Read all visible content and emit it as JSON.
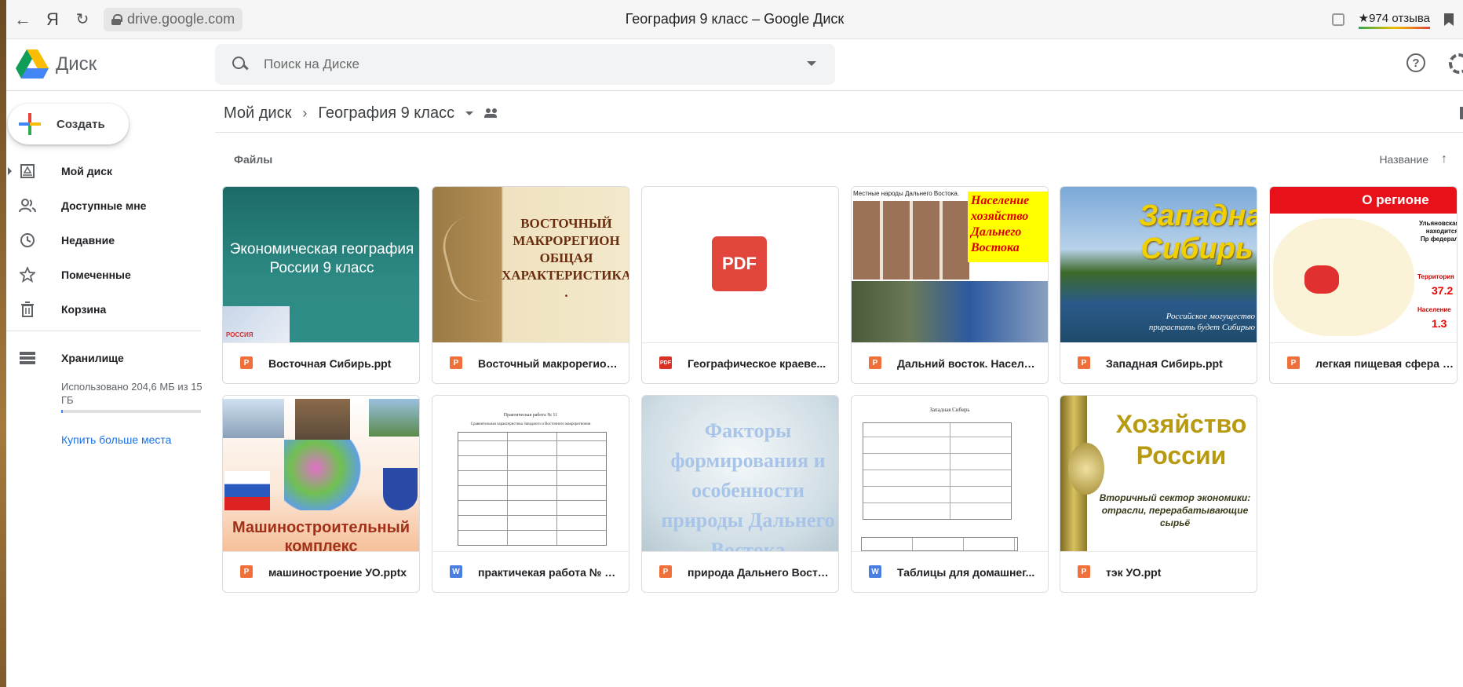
{
  "browser": {
    "url": "drive.google.com",
    "title": "География 9 класс – Google Диск",
    "reviews": "★974 отзыва",
    "logo_letter": "Я"
  },
  "header": {
    "app_name": "Диск",
    "search_placeholder": "Поиск на Диске"
  },
  "sidebar": {
    "create_label": "Создать",
    "items": [
      {
        "label": "Мой диск",
        "icon": "my-drive-icon"
      },
      {
        "label": "Доступные мне",
        "icon": "shared-icon"
      },
      {
        "label": "Недавние",
        "icon": "clock-icon"
      },
      {
        "label": "Помеченные",
        "icon": "star-icon"
      },
      {
        "label": "Корзина",
        "icon": "trash-icon"
      },
      {
        "label": "Хранилище",
        "icon": "storage-icon"
      }
    ],
    "storage_text": "Использовано 204,6 МБ из 15 ГБ",
    "storage_fraction": 0.013,
    "buy_more": "Купить больше места"
  },
  "breadcrumb": {
    "root": "Мой диск",
    "current": "География 9 класс"
  },
  "files_section": {
    "label": "Файлы",
    "sort_label": "Название"
  },
  "thumbs": {
    "t1": "Экономическая география России 9 класс",
    "t1_small": "РОССИЯ",
    "t2": "ВОСТОЧНЫЙ МАКРОРЕГИОН ОБЩАЯ ХАРАКТЕРИСТИКА .",
    "t3": "PDF",
    "t4_head": "Местные народы Дальнего Востока.",
    "t4_box": "Население хозяйство Дальнего Востока",
    "t5_big": "Западная Сибирь",
    "t5_small": "Российское могущество прирастать будет Сибирью",
    "t6_head": "О регионе",
    "t6_a": "Ульяновская находится Пр федерал",
    "t6_b": "Территория",
    "t6_c": "37.2",
    "t6_d": "Население",
    "t6_e": "1.3",
    "t7": "Машиностроительный комплекс",
    "t8_head": "Практическая работа № 11",
    "t8_sub": "Сравнительная характеристика Западного и Восточного макрорегионов",
    "t9": "Факторы формирования и особенности природы Дальнего Востока",
    "t10_head": "Западная Сибирь",
    "t11_big": "Хозяйство России",
    "t11_small": "Вторичный сектор экономики: отрасли, перерабатывающие сырьё"
  },
  "files": [
    {
      "name": "Восточная Сибирь.ppt",
      "type": "ppt",
      "type_letter": "P"
    },
    {
      "name": "Восточный макрорегион...",
      "type": "ppt",
      "type_letter": "P"
    },
    {
      "name": "Географическое краеве...",
      "type": "pdf",
      "type_letter": "PDF"
    },
    {
      "name": "Дальний восток. Населе...",
      "type": "ppt",
      "type_letter": "P"
    },
    {
      "name": "Западная Сибирь.ppt",
      "type": "ppt",
      "type_letter": "P"
    },
    {
      "name": "легкая пищевая сфера у...",
      "type": "ppt",
      "type_letter": "P"
    },
    {
      "name": "машиностроение УО.pptx",
      "type": "ppt",
      "type_letter": "P"
    },
    {
      "name": "практичекая работа № 1...",
      "type": "doc",
      "type_letter": "W"
    },
    {
      "name": "природа Дальнего Восто...",
      "type": "ppt",
      "type_letter": "P"
    },
    {
      "name": "Таблицы для домашнег...",
      "type": "doc",
      "type_letter": "W"
    },
    {
      "name": "тэк УО.ppt",
      "type": "ppt",
      "type_letter": "P"
    }
  ],
  "colors": {
    "accent": "#1a73e8",
    "ppt": "#f0703c",
    "pdf": "#d93025",
    "doc": "#4a7ee0"
  }
}
